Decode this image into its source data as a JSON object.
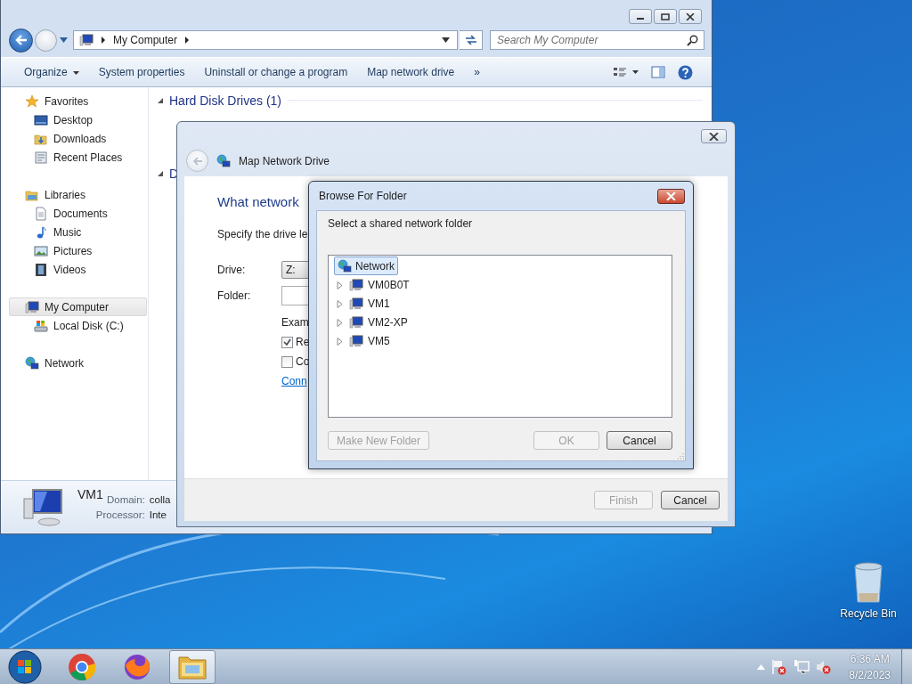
{
  "explorer": {
    "address": [
      "My Computer"
    ],
    "search_placeholder": "Search My Computer",
    "toolbar": [
      {
        "label": "Organize",
        "kind": "menu"
      },
      {
        "label": "System properties",
        "kind": "plain"
      },
      {
        "label": "Uninstall or change a program",
        "kind": "plain"
      },
      {
        "label": "Map network drive",
        "kind": "plain"
      },
      {
        "label": "»",
        "kind": "plain"
      }
    ],
    "sidebar": [
      {
        "label": "Favorites",
        "kind": "star",
        "selected": false,
        "children": [
          {
            "label": "Desktop",
            "kind": "desktop",
            "selected": false
          },
          {
            "label": "Downloads",
            "kind": "downloads",
            "selected": false
          },
          {
            "label": "Recent Places",
            "kind": "recent",
            "selected": false
          }
        ]
      },
      {
        "label": "Libraries",
        "kind": "library",
        "selected": false,
        "children": [
          {
            "label": "Documents",
            "kind": "documents",
            "selected": false
          },
          {
            "label": "Music",
            "kind": "music",
            "selected": false
          },
          {
            "label": "Pictures",
            "kind": "pictures",
            "selected": false
          },
          {
            "label": "Videos",
            "kind": "videos",
            "selected": false
          }
        ]
      },
      {
        "label": "My Computer",
        "kind": "computer",
        "selected": true,
        "children": [
          {
            "label": "Local Disk (C:)",
            "kind": "disk",
            "selected": false
          }
        ]
      },
      {
        "label": "Network",
        "kind": "network",
        "selected": false
      }
    ],
    "sections": [
      {
        "title": "Hard Disk Drives (1)"
      },
      {
        "title": "D"
      }
    ],
    "details": {
      "name": "VM1",
      "lines": [
        {
          "label": "Domain:",
          "value": "colla"
        },
        {
          "label": "Processor:",
          "value": "Inte"
        }
      ]
    }
  },
  "map_drive": {
    "title": "Map Network Drive",
    "heading": "What network",
    "instruction": "Specify the drive le",
    "drive_label": "Drive:",
    "drive_value": "Z:",
    "folder_label": "Folder:",
    "example": "Exam",
    "options": [
      {
        "label": "Re",
        "checked": true
      },
      {
        "label": "Co",
        "checked": false
      }
    ],
    "link": "Conn",
    "buttons": [
      {
        "label": "Finish",
        "disabled": true
      },
      {
        "label": "Cancel",
        "disabled": false
      }
    ]
  },
  "browse": {
    "title": "Browse For Folder",
    "prompt": "Select a shared network folder",
    "tree": [
      {
        "label": "Network",
        "selected": true,
        "children": [
          {
            "label": "VM0B0T",
            "selected": false,
            "expanded": false
          },
          {
            "label": "VM1",
            "selected": false,
            "expanded": false
          },
          {
            "label": "VM2-XP",
            "selected": false,
            "expanded": false
          },
          {
            "label": "VM5",
            "selected": false,
            "expanded": false
          }
        ]
      }
    ],
    "left_button": {
      "label": "Make New Folder",
      "disabled": true
    },
    "buttons": [
      {
        "label": "OK",
        "disabled": true
      },
      {
        "label": "Cancel",
        "disabled": false
      }
    ]
  },
  "desktop": {
    "icons": [
      {
        "label": "Recycle Bin"
      }
    ]
  },
  "taskbar": {
    "apps": [
      {
        "kind": "chrome",
        "active": false
      },
      {
        "kind": "firefox",
        "active": false
      },
      {
        "kind": "explorer",
        "active": true
      }
    ],
    "clock": {
      "time": "6:36 AM",
      "date": "8/2/2023"
    }
  }
}
